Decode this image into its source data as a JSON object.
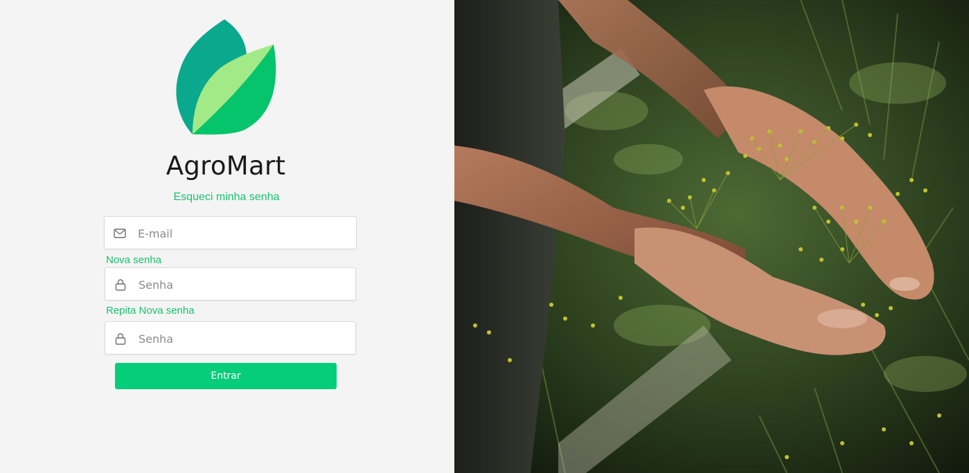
{
  "brand": {
    "name": "AgroMart"
  },
  "links": {
    "forgot_password": "Esqueci minha senha"
  },
  "form": {
    "email": {
      "placeholder": "E-mail",
      "value": ""
    },
    "new_password_label": "Nova senha",
    "new_password": {
      "placeholder": "Senha",
      "value": ""
    },
    "repeat_password_label": "Repita Nova senha",
    "repeat_password": {
      "placeholder": "Senha",
      "value": ""
    },
    "submit_label": "Entrar"
  },
  "icons": {
    "email": "mail-icon",
    "password": "lock-icon",
    "logo": "leaf-logo"
  },
  "colors": {
    "accent": "#05cd7a",
    "link": "#18c26e",
    "logo_teal": "#0aa98d",
    "logo_light": "#a2e987",
    "logo_green": "#06c46b",
    "background": "#f4f4f4"
  }
}
